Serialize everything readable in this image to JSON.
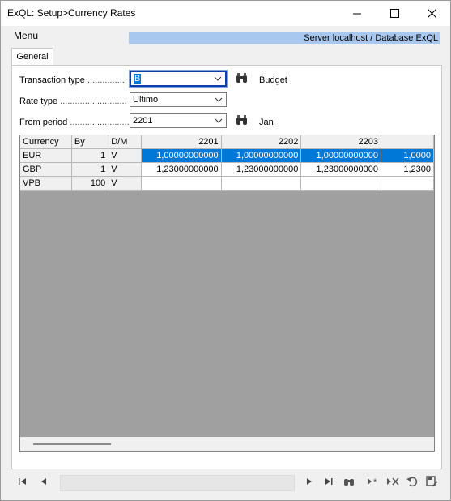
{
  "window": {
    "title": "ExQL: Setup>Currency Rates"
  },
  "menubar": {
    "menu_label": "Menu",
    "server_info": "Server localhost / Database ExQL"
  },
  "tabs": [
    {
      "label": "General"
    }
  ],
  "form": {
    "transaction_type": {
      "label": "Transaction type",
      "dots": "...............",
      "value": "B",
      "aux": "Budget"
    },
    "rate_type": {
      "label": "Rate type",
      "dots": "...........................",
      "value": "Ultimo"
    },
    "from_period": {
      "label": "From period",
      "dots": ".........................",
      "value": "2201",
      "aux": "Jan"
    }
  },
  "grid": {
    "columns": [
      "Currency",
      "By",
      "D/M",
      "2201",
      "2202",
      "2203",
      ""
    ],
    "rows": [
      {
        "currency": "EUR",
        "by": "1",
        "dm": "V",
        "values": [
          "1,00000000000",
          "1,00000000000",
          "1,00000000000",
          "1,0000"
        ],
        "selected": true
      },
      {
        "currency": "GBP",
        "by": "1",
        "dm": "V",
        "values": [
          "1,23000000000",
          "1,23000000000",
          "1,23000000000",
          "1,2300"
        ],
        "selected": false
      },
      {
        "currency": "VPB",
        "by": "100",
        "dm": "V",
        "values": [
          "",
          "",
          "",
          ""
        ],
        "selected": false
      }
    ]
  },
  "colors": {
    "selection": "#0078d7",
    "server_bar": "#a8c8f0",
    "grid_empty": "#a0a0a0",
    "focus_border": "#0b3fa8"
  },
  "icons": {
    "window": [
      "minimize-icon",
      "maximize-icon",
      "close-icon"
    ],
    "nav": [
      "first-record-icon",
      "previous-record-icon",
      "next-record-icon",
      "last-record-icon",
      "find-icon",
      "new-record-icon",
      "delete-record-icon",
      "undo-icon",
      "save-icon"
    ]
  }
}
